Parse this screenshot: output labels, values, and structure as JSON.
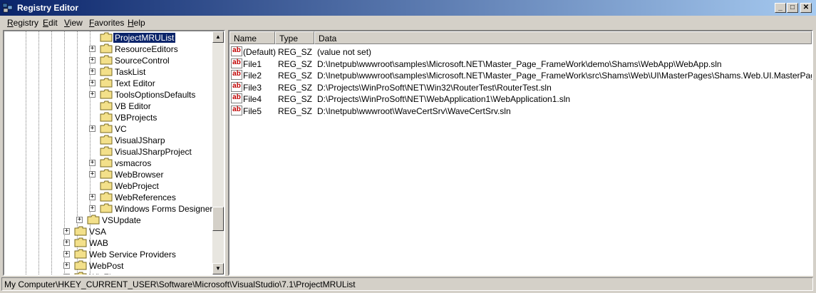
{
  "window": {
    "title": "Registry Editor",
    "min_glyph": "_",
    "max_glyph": "□",
    "close_glyph": "✕"
  },
  "menu": [
    {
      "first": "R",
      "rest": "egistry"
    },
    {
      "first": "E",
      "rest": "dit"
    },
    {
      "first": "V",
      "rest": "iew"
    },
    {
      "first": "F",
      "rest": "avorites"
    },
    {
      "first": "H",
      "rest": "elp"
    }
  ],
  "tree": {
    "items": [
      {
        "label": "ProjectMRUList",
        "expander": "",
        "selected": true
      },
      {
        "label": "ResourceEditors",
        "expander": "+"
      },
      {
        "label": "SourceControl",
        "expander": "+"
      },
      {
        "label": "TaskList",
        "expander": "+"
      },
      {
        "label": "Text Editor",
        "expander": "+"
      },
      {
        "label": "ToolsOptionsDefaults",
        "expander": "+"
      },
      {
        "label": "VB Editor",
        "expander": ""
      },
      {
        "label": "VBProjects",
        "expander": ""
      },
      {
        "label": "VC",
        "expander": "+"
      },
      {
        "label": "VisualJSharp",
        "expander": ""
      },
      {
        "label": "VisualJSharpProject",
        "expander": ""
      },
      {
        "label": "vsmacros",
        "expander": "+"
      },
      {
        "label": "WebBrowser",
        "expander": "+"
      },
      {
        "label": "WebProject",
        "expander": ""
      },
      {
        "label": "WebReferences",
        "expander": "+"
      },
      {
        "label": "Windows Forms Designer",
        "expander": "+"
      },
      {
        "label": "VSUpdate",
        "expander": "+"
      },
      {
        "label": "VSA",
        "expander": "+"
      },
      {
        "label": "WAB",
        "expander": "+"
      },
      {
        "label": "Web Service Providers",
        "expander": "+"
      },
      {
        "label": "WebPost",
        "expander": "+"
      },
      {
        "label": "WinZip",
        "expander": "+"
      }
    ]
  },
  "list": {
    "columns": [
      "Name",
      "Type",
      "Data"
    ],
    "rows": [
      {
        "name": "(Default)",
        "type": "REG_SZ",
        "data": "(value not set)"
      },
      {
        "name": "File1",
        "type": "REG_SZ",
        "data": "D:\\Inetpub\\wwwroot\\samples\\Microsoft.NET\\Master_Page_FrameWork\\demo\\Shams\\WebApp\\WebApp.sln"
      },
      {
        "name": "File2",
        "type": "REG_SZ",
        "data": "D:\\Inetpub\\wwwroot\\samples\\Microsoft.NET\\Master_Page_FrameWork\\src\\Shams\\Web\\UI\\MasterPages\\Shams.Web.UI.MasterPages.csproj"
      },
      {
        "name": "File3",
        "type": "REG_SZ",
        "data": "D:\\Projects\\WinProSoft\\NET\\Win32\\RouterTest\\RouterTest.sln"
      },
      {
        "name": "File4",
        "type": "REG_SZ",
        "data": "D:\\Projects\\WinProSoft\\NET\\WebApplication1\\WebApplication1.sln"
      },
      {
        "name": "File5",
        "type": "REG_SZ",
        "data": "D:\\Inetpub\\wwwroot\\WaveCertSrv\\WaveCertSrv.sln"
      }
    ],
    "value_icon_text": "ab"
  },
  "status": {
    "path": "My Computer\\HKEY_CURRENT_USER\\Software\\Microsoft\\VisualStudio\\7.1\\ProjectMRUList"
  },
  "colors": {
    "titlebar_start": "#0a246a",
    "titlebar_end": "#a6caf0",
    "chrome": "#d4d0c8",
    "selection": "#0a246a",
    "folder": "#f3e08a"
  }
}
